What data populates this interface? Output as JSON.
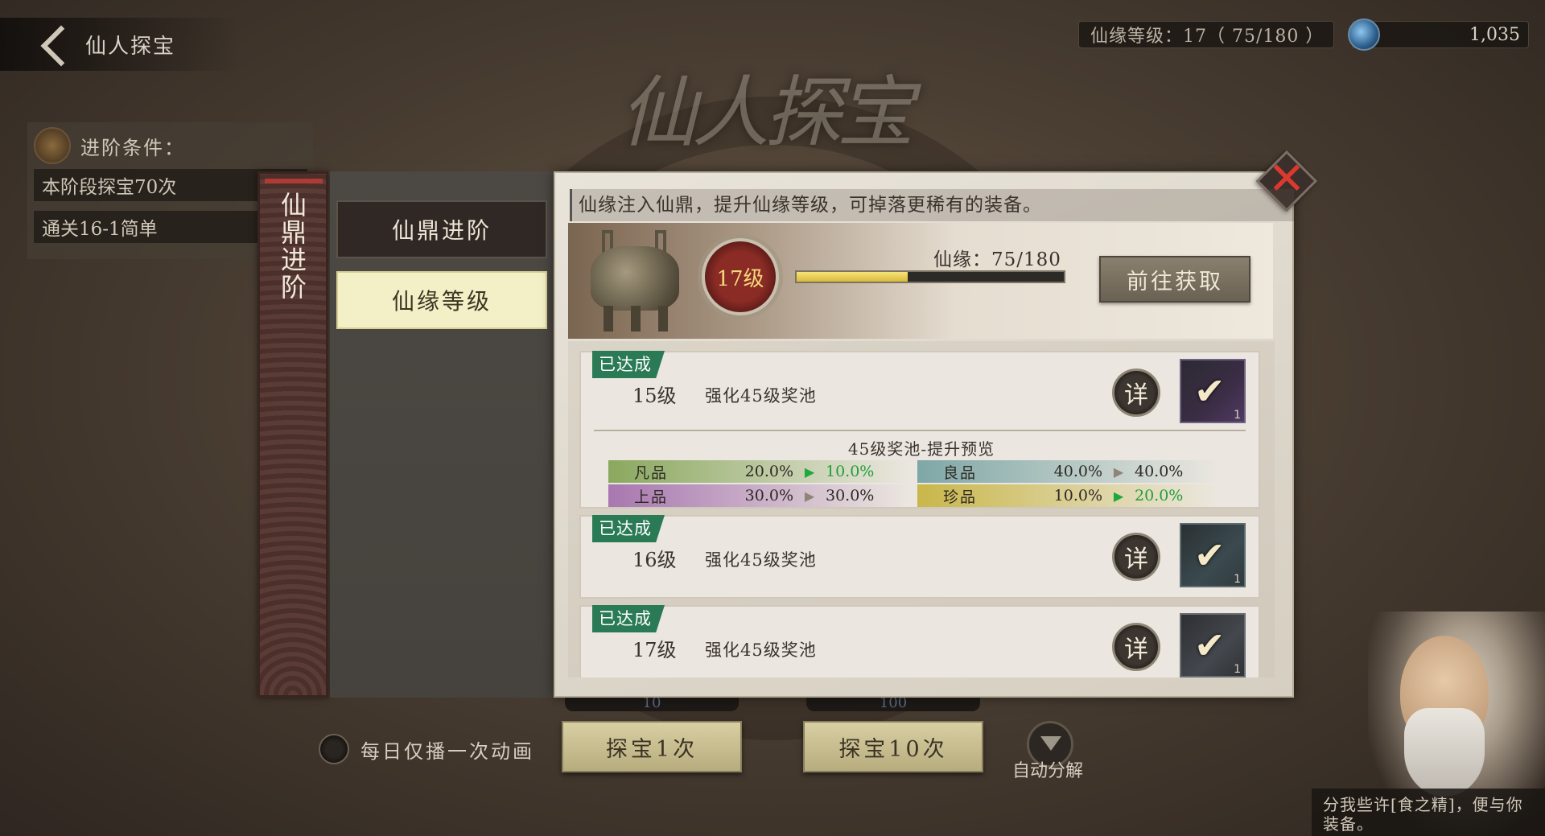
{
  "header": {
    "title": "仙人探宝",
    "xianyuan_level_text": "仙缘等级：17（ 75/180 ）",
    "coins": "1,035",
    "big_title": "仙人探宝"
  },
  "conditions": {
    "title": "进阶条件：",
    "items": [
      "本阶段探宝70次",
      "通关16-1简单"
    ]
  },
  "side_tab": {
    "label": "仙鼎进阶"
  },
  "menu": {
    "items": [
      {
        "label": "仙鼎进阶",
        "selected": false
      },
      {
        "label": "仙缘等级",
        "selected": true
      }
    ]
  },
  "panel": {
    "description": "仙缘注入仙鼎，提升仙缘等级，可掉落更稀有的装备。",
    "level_badge": "17级",
    "xianyuan_label": "仙缘：75/180",
    "progress": {
      "current": 75,
      "max": 180
    },
    "goto_button": "前往获取",
    "close_icon": "close-icon"
  },
  "rewards": [
    {
      "tag": "已达成",
      "level": "15级",
      "text": "强化45级奖池",
      "detail": "详",
      "item_count": "1",
      "preview": {
        "title": "45级奖池-提升预览",
        "rows": [
          {
            "name": "凡品",
            "from": "20.0%",
            "to": "10.0%",
            "change": "up",
            "color": "#8aa85e"
          },
          {
            "name": "良品",
            "from": "40.0%",
            "to": "40.0%",
            "change": "same",
            "color": "#7ea7a6"
          },
          {
            "name": "上品",
            "from": "30.0%",
            "to": "30.0%",
            "change": "same",
            "color": "#a877b0"
          },
          {
            "name": "珍品",
            "from": "10.0%",
            "to": "20.0%",
            "change": "up",
            "color": "#c9b74a"
          }
        ]
      }
    },
    {
      "tag": "已达成",
      "level": "16级",
      "text": "强化45级奖池",
      "detail": "详",
      "item_count": "1"
    },
    {
      "tag": "已达成",
      "level": "17级",
      "text": "强化45级奖池",
      "detail": "详",
      "item_count": "1"
    }
  ],
  "bottom": {
    "daily_anim_label": "每日仅播一次动画",
    "cost1": "10",
    "cost10": "100",
    "draw1": "探宝1次",
    "draw10": "探宝10次",
    "auto_label": "自动分解"
  },
  "npc": {
    "speech": "分我些许[食之精]，便与你装备。"
  }
}
